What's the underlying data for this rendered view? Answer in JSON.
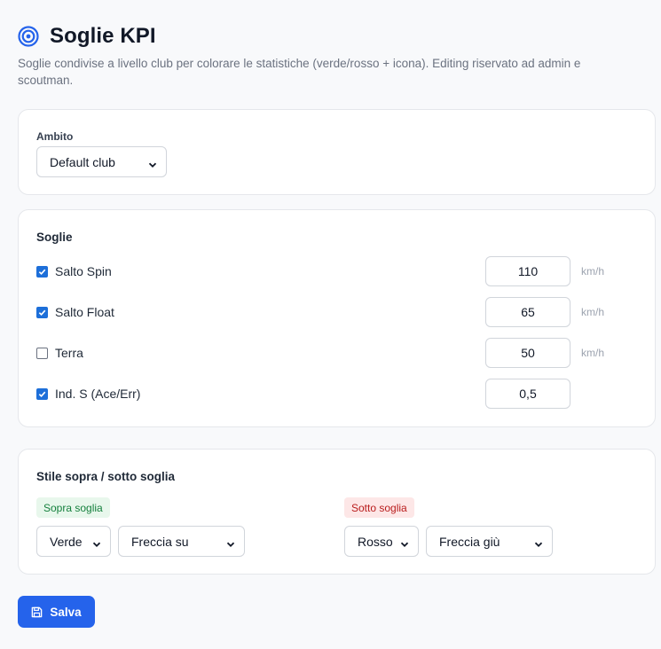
{
  "header": {
    "title": "Soglie KPI",
    "title_icon": "target-icon",
    "subtitle": "Soglie condivise a livello club per colorare le statistiche (verde/rosso + icona). Editing riservato ad admin e scoutman."
  },
  "ambito": {
    "label": "Ambito",
    "selected": "Default club"
  },
  "soglie": {
    "title": "Soglie",
    "rows": [
      {
        "label": "Salto Spin",
        "checked": true,
        "value": "110",
        "unit": "km/h"
      },
      {
        "label": "Salto Float",
        "checked": true,
        "value": "65",
        "unit": "km/h"
      },
      {
        "label": "Terra",
        "checked": false,
        "value": "50",
        "unit": "km/h"
      },
      {
        "label": "Ind. S (Ace/Err)",
        "checked": true,
        "value": "0,5",
        "unit": ""
      }
    ]
  },
  "stile": {
    "title": "Stile sopra / sotto soglia",
    "sopra": {
      "badge": "Sopra soglia",
      "color": "Verde",
      "icon": "Freccia su"
    },
    "sotto": {
      "badge": "Sotto soglia",
      "color": "Rosso",
      "icon": "Freccia giù"
    }
  },
  "actions": {
    "save_label": "Salva",
    "save_icon": "save-icon"
  },
  "colors": {
    "accent": "#2563eb",
    "checkbox": "#1d6fd9",
    "positive_bg": "#e8f7ec",
    "positive_text": "#15803d",
    "negative_bg": "#fde7e7",
    "negative_text": "#b91c1c"
  }
}
